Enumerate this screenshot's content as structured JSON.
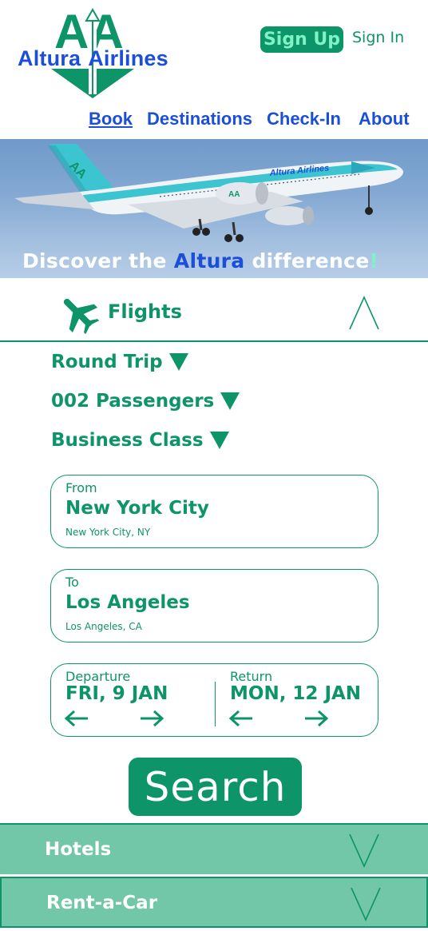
{
  "brand": {
    "initials": "AA",
    "name_part1": "Altura",
    "name_part2": "Airlines"
  },
  "header": {
    "signup_label": "Sign Up",
    "signin_label": "Sign In"
  },
  "nav": {
    "book": "Book",
    "destinations": "Destinations",
    "checkin": "Check-In",
    "about": "About"
  },
  "hero": {
    "tagline_pre": "Discover the ",
    "tagline_brand": "Altura",
    "tagline_post": " difference",
    "tagline_end": "!",
    "plane_livery": "Altura Airlines"
  },
  "flights": {
    "label": "Flights",
    "trip_type": "Round Trip",
    "passengers": "002 Passengers",
    "cabin_class": "Business Class",
    "from": {
      "label": "From",
      "city": "New York City",
      "detail": "New York City, NY"
    },
    "to": {
      "label": "To",
      "city": "Los Angeles",
      "detail": "Los Angeles, CA"
    },
    "departure": {
      "label": "Departure",
      "date": "FRI, 9 JAN"
    },
    "return": {
      "label": "Return",
      "date": "MON, 12 JAN"
    },
    "search_label": "Search"
  },
  "accordions": {
    "hotels": "Hotels",
    "rent_a_car": "Rent-a-Car"
  },
  "colors": {
    "brand_green": "#0d9468",
    "brand_blue": "#1b4fd8",
    "mint": "#7ff2c6",
    "accordion_bg": "#72c7a8"
  },
  "icons": [
    "plane-icon",
    "chevron-up-icon",
    "dropdown-triangle-icon",
    "arrow-left-icon",
    "arrow-right-icon",
    "chevron-down-icon"
  ]
}
